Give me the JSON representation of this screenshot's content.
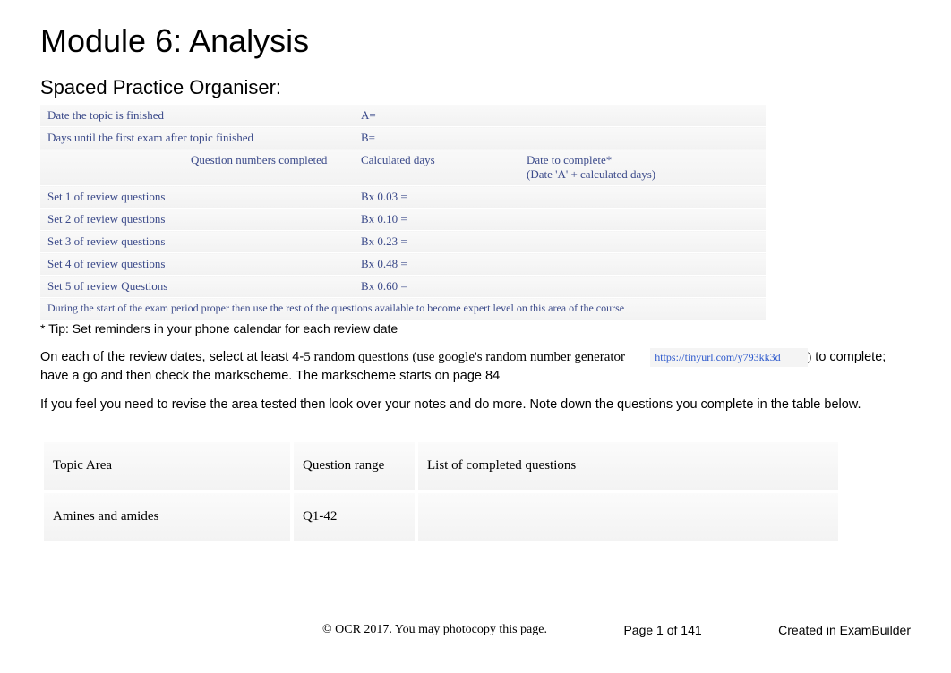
{
  "title": "Module 6: Analysis",
  "subtitle": "Spaced Practice Organiser:",
  "organiser": {
    "row_date_finished_label": "Date the topic is  finished",
    "row_date_finished_value": "A=",
    "row_days_until_label": "Days until the first exam after topic finished",
    "row_days_until_value": "B=",
    "col_headers": {
      "blank": "",
      "question_numbers": "Question numbers completed",
      "calculated_days": "Calculated days",
      "date_to_complete": "Date to complete*",
      "date_to_complete_sub": "(Date 'A' + calculated days)"
    },
    "sets": [
      {
        "label": "Set 1 of review questions",
        "calc": "Bx 0.03 ="
      },
      {
        "label": "Set 2 of review questions",
        "calc": "Bx 0.10 ="
      },
      {
        "label": "Set 3 of review questions",
        "calc": "Bx 0.23 ="
      },
      {
        "label": "Set 4 of review questions",
        "calc": "Bx 0.48 ="
      },
      {
        "label": "Set 5 of review Questions",
        "calc": "Bx 0.60 ="
      }
    ],
    "expert_note": "During the start of the exam period proper then use the rest of the questions available to become expert level on this area of the course"
  },
  "tip": "* Tip: Set reminders in your phone calendar for each review date",
  "instruction": {
    "part1": "On each of the review dates, select at least 4-",
    "part1_serif": "5 random questions (use google's random number generator",
    "link": "https://tinyurl.com/y793kk3d",
    "paren_close": ")",
    "part2": " to complete; have a go and then check the markscheme. The markscheme starts on page 84"
  },
  "revise_note": "If you feel you need to revise the area tested then look over your notes and do more. Note down the questions you complete in the table below.",
  "topic_table": {
    "headers": {
      "topic": "Topic Area",
      "range": "Question range",
      "completed": "List of completed questions"
    },
    "rows": [
      {
        "topic": "Amines and amides",
        "range": "Q1-42",
        "completed": ""
      }
    ]
  },
  "footer": {
    "copyright": "© OCR 2017. You may photocopy this page.",
    "page": "Page 1 of 141",
    "created": "Created in ExamBuilder"
  }
}
